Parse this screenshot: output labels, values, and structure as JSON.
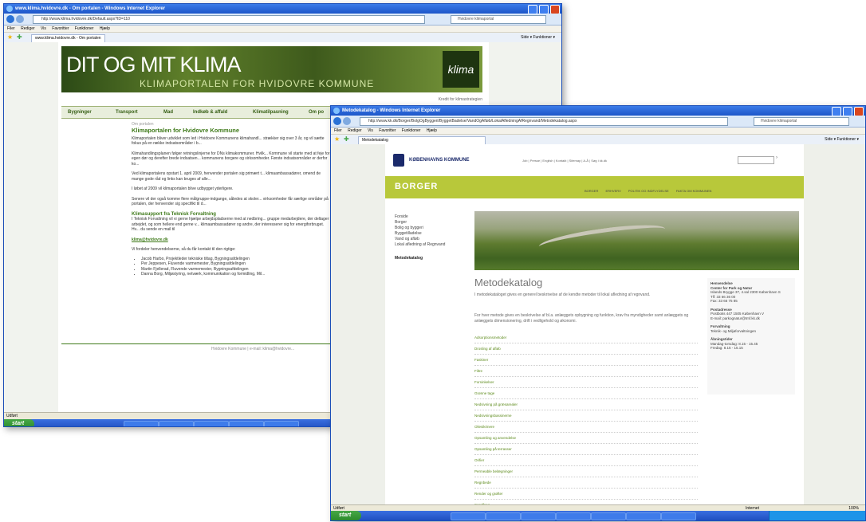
{
  "win1": {
    "title": "www.klima.hvidovre.dk - Om portalen - Windows Internet Explorer",
    "address": "http://www.klima.hvidovre.dk/Default.aspx?ID=110",
    "search": "Hvidovre klimaportal",
    "menu": [
      "Filer",
      "Rediger",
      "Vis",
      "Favoritter",
      "Funktioner",
      "Hjælp"
    ],
    "tab": "www.klima.hvidovre.dk - Om portalen",
    "tools": "Side ▾  Funktioner ▾",
    "banner_title": "DIT OG MIT KLIMA",
    "banner_sub": "KLIMAPORTALEN FOR HVIDOVRE KOMMUNE",
    "logo": "klima",
    "nav": [
      "Bygninger",
      "Transport",
      "Mad",
      "Indkøb & affald",
      "Klimatilpasning",
      "Om po"
    ],
    "right_tag": "Kredit for klimastrategien",
    "breadcrumb": "Om portalen",
    "heading": "Klimaportalen for Hvidovre Kommune",
    "p1": "Klimaportalen bliver udviklet som led i Hvidovre Kommunens klimahandl... strækker sig over 3 år, og vil sætte fokus på en række indsatsområder i b...",
    "p2": "Klimahandlingsplanen følger retningslinjerne for DNs klimakommuner. Hvilk... Kommune vil starte med at feje for egen dør og derefter brede indsatsen... kommunens borgere og virksomheder. Første indsatsområder er derfor ko...",
    "p3": "Ved klimaportalens opstart 1. april 2009, henvender portalen sig primært t... klimaambassadører, omend de mange gode råd og links kan bruges af alle...",
    "p4": "I løbet af 2009 vil klimaportalen blive udbygget yderligere.",
    "p5": "Senere vil der også komme flere målgruppe-indgange, således at skoler... virksomheder får særlige områder på portalen, der henvender sig specifikt til d...",
    "h2": "Klimasupport fra Teknisk Forvaltning",
    "p6": "I Teknisk Forvaltning vil vi gerne hjælpe arbejdspladserne med at nedbring... gruppe medarbejdere, der deltager i arbejdet, og som hellere end gerne v... klimaambassadører og andre, der interesserer sig for energiforbruget. Hv... du sende en mail til",
    "email": "klima@hvidovre.dk",
    "p7": "Vi fordeler henvendelserne, så du får kontakt til den rigtige:",
    "list": [
      "Jacob Harbo, Projektleder tekniske tiltag, Bygningsafdelingen",
      "Per Jeppesen, Fluvende varmemester, Bygningsafdelingen",
      "Martin Fjellerad, Fluvende varmemester, Bygningsafdelingen",
      "Danna Borg, Miljøstyring, netværk, kommunikation og formidling, Mil..."
    ],
    "footer": "Hvidovre Kommune | e-mail: klima@hvidovre...",
    "status": "Udført"
  },
  "win2": {
    "title": "Metodekatalog - Windows Internet Explorer",
    "address": "http://www.kk.dk/Borger/BolgOgByggeri/ByggetBadelse/VandOgAfløb/LokalAfledningAfRegnvand/Metodekatalog.aspx",
    "search": "Hvidovre klimaportal",
    "menu": [
      "Filer",
      "Rediger",
      "Vis",
      "Favoritter",
      "Funktioner",
      "Hjælp"
    ],
    "tab": "Metodekatalog",
    "tools": "Side ▾  Funktioner ▾",
    "org": "KØBENHAVNS KOMMUNE",
    "toplinks": "Job | Presse | English | Kontakt | Sitemap | A-Å | Søg i kk.dk",
    "section": "BORGER",
    "subnav": [
      "BORGER",
      "ERHVERV",
      "POLITIK OG INDFLYDELSE",
      "FAKTA OM KOMMUNEN"
    ],
    "leftnav": [
      "Forside",
      "Borger",
      "Bolig og byggeri",
      "Byggetilladelse",
      "Vand og afløb",
      "Lokal afledning af Regnvand"
    ],
    "leftnav_active": "Metodekatalog",
    "mk_title": "Metodekatalog",
    "mk_intro": "I metodekataloget gives en generel beskrivelse af de kendte metoder til lokal afledning af regnvand.",
    "mk_intro2": "For hver metode gives en beskrivelse af bl.a. anlæggets opbygning og funktion, krav fra myndigheder samt anlæggets og anlæggets dimensionering, drift i vedligehold og økonomi.",
    "mk_list": [
      "Adsorptionsmetoder",
      "Drosling af afløb",
      "Faskiner",
      "Filtre",
      "Forsinkelser",
      "Grønne tage",
      "Nedsivning på græsarealer",
      "Nedsivningsbassinerne",
      "Oliesikrinere",
      "Opsamling og anvendelse",
      "Opsamling på terrasser",
      "Orifier",
      "Permeable belægninger",
      "Regnbede",
      "Render og grøfter",
      "Sandfang"
    ],
    "contact": {
      "h1": "Henvendelse",
      "org": "Center for Park og Natur",
      "addr": "Islands Brygge 37, 4.sal 2300 København S",
      "tlf": "Tlf: 33 66 36 00",
      "fax": "Fax: 33 66 75 85",
      "h2": "Postadresse",
      "paddr": "Postboks 447 1505 København V",
      "email": "E-mail: parkognatur@tmf.kk.dk",
      "h3": "Forvaltning",
      "forv": "Teknik- og Miljøforvaltningen",
      "h4": "Åbningstider",
      "hours1": "Mandag-torsdag: 8.15 - 15.45",
      "hours2": "Fredag: 8.15 - 15.15"
    },
    "status": "Udført",
    "zone": "Internet",
    "zoom": "100%"
  },
  "taskbar": {
    "start": "start"
  }
}
